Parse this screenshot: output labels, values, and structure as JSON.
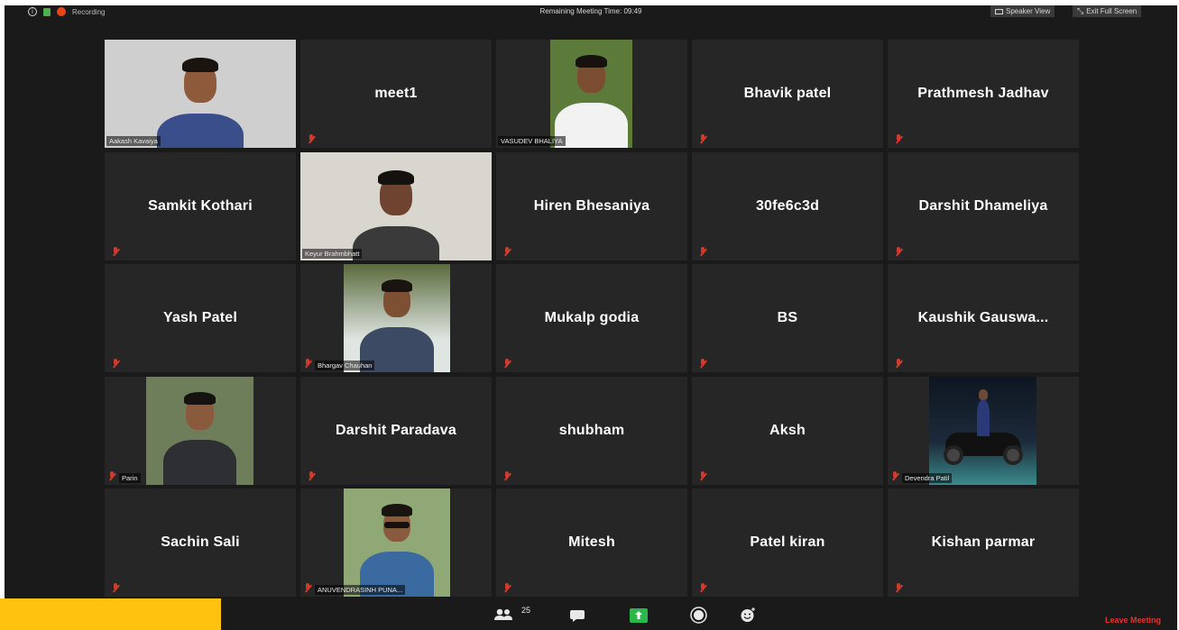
{
  "topbar": {
    "recording_label": "Recording",
    "timer_text": "Remaining Meeting Time: 09:49",
    "speaker_view_label": "Speaker View",
    "exit_full_screen_label": "Exit Full Screen"
  },
  "tiles": [
    {
      "type": "video",
      "label": "Aakash Kavaiya",
      "muted": false
    },
    {
      "type": "name",
      "name": "meet1",
      "muted": true
    },
    {
      "type": "video",
      "label": "VASUDEV BHALIYA",
      "muted": false
    },
    {
      "type": "name",
      "name": "Bhavik patel",
      "muted": true
    },
    {
      "type": "name",
      "name": "Prathmesh Jadhav",
      "muted": true
    },
    {
      "type": "name",
      "name": "Samkit Kothari",
      "muted": true
    },
    {
      "type": "video",
      "label": "Keyur Brahmbhatt",
      "muted": false,
      "active": true
    },
    {
      "type": "name",
      "name": "Hiren Bhesaniya",
      "muted": true
    },
    {
      "type": "name",
      "name": "30fe6c3d",
      "muted": true
    },
    {
      "type": "name",
      "name": "Darshit Dhameliya",
      "muted": true
    },
    {
      "type": "name",
      "name": "Yash Patel",
      "muted": true
    },
    {
      "type": "video",
      "label": "Bhargav Chauhan",
      "muted": true
    },
    {
      "type": "name",
      "name": "Mukalp godia",
      "muted": true
    },
    {
      "type": "name",
      "name": "BS",
      "muted": true
    },
    {
      "type": "name",
      "name": "Kaushik  Gauswa...",
      "muted": true
    },
    {
      "type": "video",
      "label": "Parin",
      "muted": true
    },
    {
      "type": "name",
      "name": "Darshit Paradava",
      "muted": true
    },
    {
      "type": "name",
      "name": "shubham",
      "muted": true
    },
    {
      "type": "name",
      "name": "Aksh",
      "muted": true
    },
    {
      "type": "video",
      "label": "Devendra Patil",
      "muted": true
    },
    {
      "type": "name",
      "name": "Sachin Sali",
      "muted": true
    },
    {
      "type": "video",
      "label": "ANUVENDRASINH PUNA...",
      "muted": true
    },
    {
      "type": "name",
      "name": "Mitesh",
      "muted": true
    },
    {
      "type": "name",
      "name": "Patel kiran",
      "muted": true
    },
    {
      "type": "name",
      "name": "Kishan parmar",
      "muted": true
    }
  ],
  "toolbar": {
    "participants_count": "25",
    "leave_label": "Leave Meeting",
    "share_color": "#2bb84a",
    "icons": [
      "participants-icon",
      "chat-icon",
      "share-screen-icon",
      "record-icon",
      "reactions-icon"
    ]
  },
  "colors": {
    "background": "#1a1a1a",
    "tile": "#262626",
    "active_border": "#c6e26a",
    "muted": "#d33a2c",
    "leave": "#e0352b",
    "overlay": "#ffc20e"
  }
}
